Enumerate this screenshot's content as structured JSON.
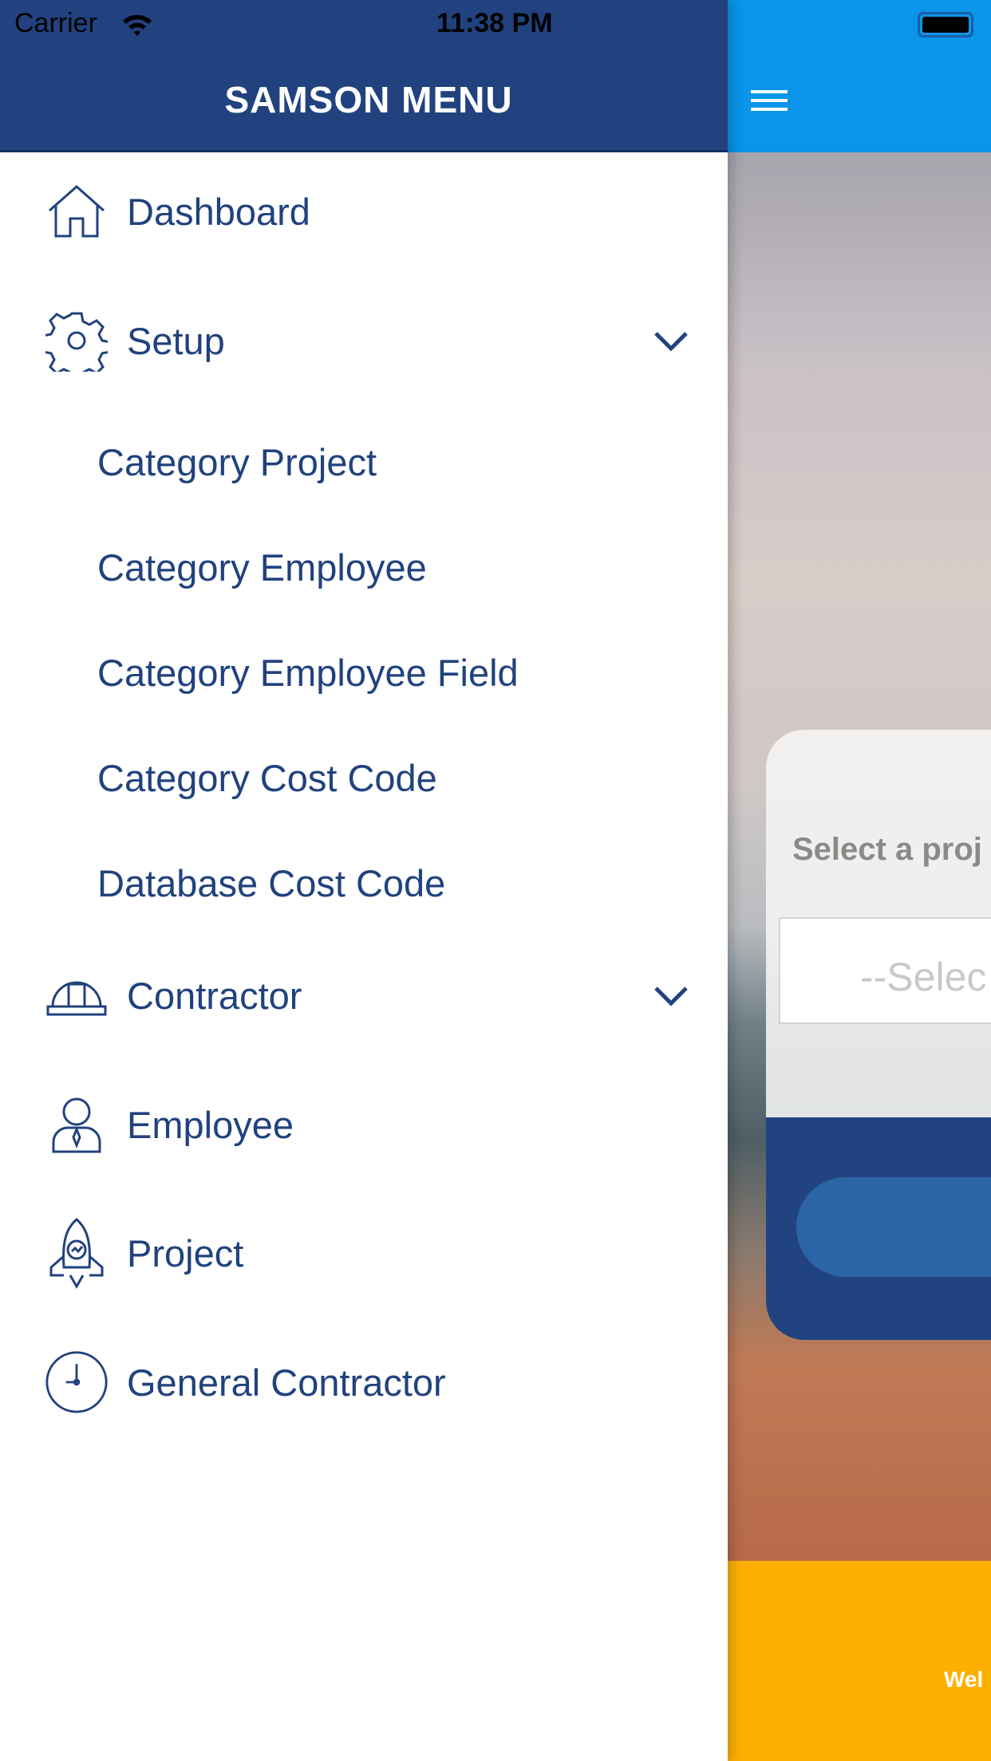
{
  "status_bar": {
    "carrier": "Carrier",
    "time": "11:38 PM"
  },
  "drawer": {
    "title": "SAMSON MENU",
    "items": [
      {
        "label": "Dashboard",
        "icon": "home-icon"
      },
      {
        "label": "Setup",
        "icon": "gear-icon",
        "expandable": true
      },
      {
        "label": "Category Project",
        "sub": true
      },
      {
        "label": "Category Employee",
        "sub": true
      },
      {
        "label": "Category Employee Field",
        "sub": true
      },
      {
        "label": "Category Cost Code",
        "sub": true
      },
      {
        "label": "Database Cost Code",
        "sub": true
      },
      {
        "label": "Contractor",
        "icon": "hard-hat-icon",
        "expandable": true
      },
      {
        "label": "Employee",
        "icon": "user-icon"
      },
      {
        "label": "Project",
        "icon": "rocket-icon"
      },
      {
        "label": "General Contractor",
        "icon": "clock-icon"
      }
    ]
  },
  "main": {
    "select_label": "Select a proj",
    "select_placeholder": "--Selec",
    "welcome": "Wel"
  },
  "colors": {
    "drawer_header": "#21427E",
    "app_header": "#0A95E8",
    "text": "#21427E",
    "footer": "#FDB000"
  }
}
